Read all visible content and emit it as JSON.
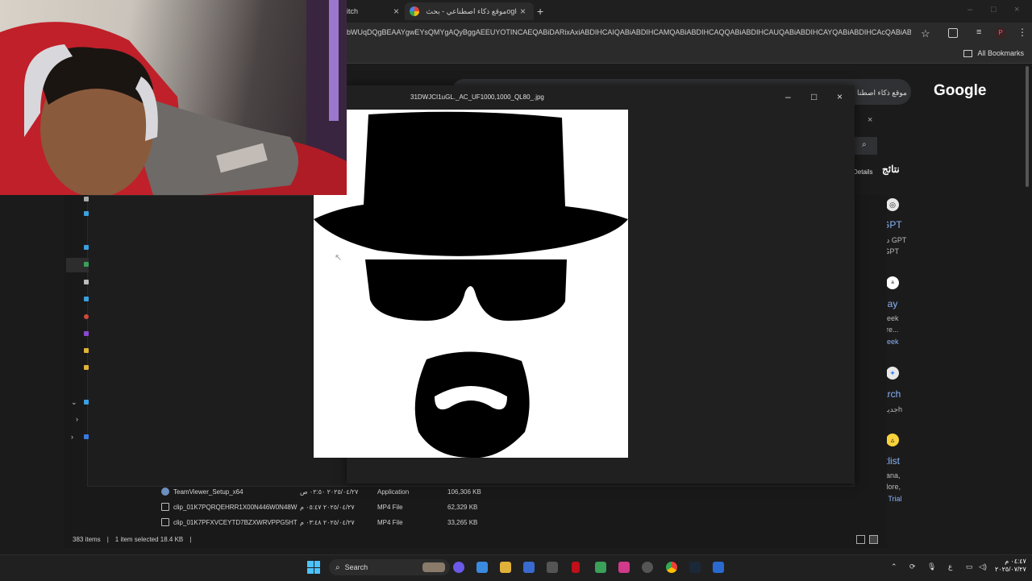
{
  "browser": {
    "tabs": [
      {
        "label": "itch"
      },
      {
        "label": "موقع ذكاء اصطناعي - بحث ‏ogle"
      }
    ],
    "new_tab_symbol": "+",
    "close_symbol": "×",
    "url": "bWUqDQgBEAAYgwEYsQMYgAQyBggAEEUYOTINCAEQABiDARixAxiABDIHCAIQABiABDIHCAMQABiABDIHCAQQABiABDIHCAUQABiABDIHCAYQABiABDIHCAcQABiABDIHCAgQABiABDIH...",
    "bookmarks_label": "All Bookmarks",
    "profile_initial": "P"
  },
  "google": {
    "logo": "Google",
    "search_query": "موقع ذكاء اصطنا",
    "results_heading": "نتائج",
    "details_label": "Details",
    "results": [
      {
        "icon": "openai-icon",
        "title": "GPT",
        "sub1": "دع GPT",
        "sub2": "tGPT"
      },
      {
        "icon": "deepseek-icon",
        "title": "day",
        "sub1": "Seek",
        "sub2": "ore...",
        "link": "Seek"
      },
      {
        "icon": "gemini-icon",
        "title": "arch",
        "sub1": "جديد ‏h"
      },
      {
        "icon": "triangle-icon",
        "title": "rtlist",
        "sub1": "nana,",
        "sub2": "More,",
        "link": "e Trial"
      }
    ]
  },
  "viewer": {
    "title": "31DWJCI1uGL._AC_UF1000,1000_QL80_.jpg",
    "minimize": "–",
    "maximize": "□",
    "close": "×"
  },
  "explorer": {
    "files": [
      {
        "name": "TeamViewer_Setup_x64",
        "date": "٢٠٢٥/٠٤/٢٧ ٠٢:٥٠ ص",
        "type": "Application",
        "size": "106,306 KB",
        "kind": "app"
      },
      {
        "name": "clip_01K7PQRQEHRR1X00N446W0N48W",
        "date": "٢٠٢٥/٠٤/٢٧ ٠٥:٤٧ م",
        "type": "MP4 File",
        "size": "62,329 KB",
        "kind": "file"
      },
      {
        "name": "clip_01K7PFXVCEYTD7BZXWRVPPG5HT",
        "date": "٢٠٢٥/٠٤/٢٧ ٠٣:٤٨ م",
        "type": "MP4 File",
        "size": "33,265 KB",
        "kind": "file"
      }
    ],
    "status_items": "383 items",
    "status_selected": "1 item selected  18.4 KB",
    "status_sep": "|"
  },
  "taskbar": {
    "search_label": "Search",
    "time": "٠٤:٤٧ م",
    "date": "٢٠٢٥/٠٧/٢٧",
    "lang": "ع"
  },
  "colors": {
    "link": "#8ab4f8",
    "accent_blue": "#4cc2ff"
  }
}
